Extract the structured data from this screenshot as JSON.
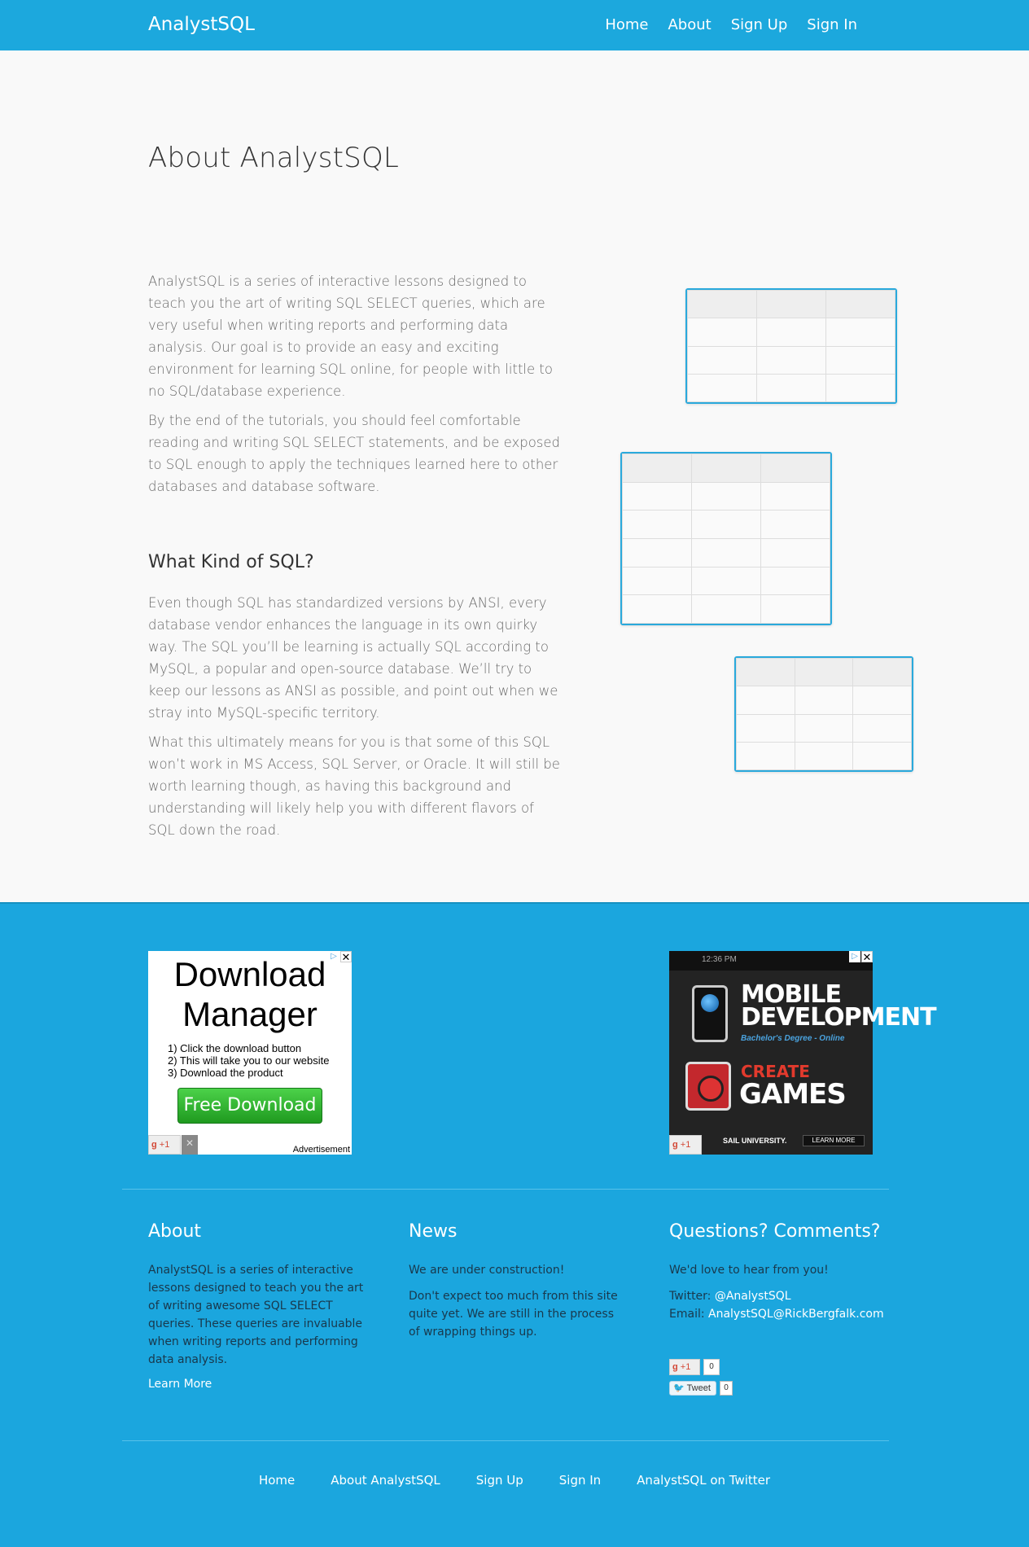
{
  "header": {
    "brand": "AnalystSQL",
    "nav": [
      "Home",
      "About",
      "Sign Up",
      "Sign In"
    ]
  },
  "main": {
    "title": "About AnalystSQL",
    "paragraphs_intro": [
      "AnalystSQL is a series of interactive lessons designed to teach you the art of writing SQL SELECT queries, which are very useful when writing reports and performing data analysis. Our goal is to provide an easy and exciting environment for learning SQL online, for people with little to no SQL/database experience.",
      "By the end of the tutorials, you should feel comfortable reading and writing SQL SELECT statements, and be exposed to SQL enough to apply the techniques learned here to other databases and database software."
    ],
    "subheading": "What Kind of SQL?",
    "paragraphs_sql": [
      "Even though SQL has standardized versions by ANSI, every database vendor enhances the language in its own quirky way. The SQL you’ll be learning is actually SQL according to MySQL, a popular and open-source database. We’ll try to keep our lessons as ANSI as possible, and point out when we stray into MySQL-specific territory.",
      "What this ultimately means for you is that some of this SQL won’t work in MS Access, SQL Server, or Oracle. It will still be worth learning though, as having this background and understanding will likely help you with different flavors of SQL down the road."
    ]
  },
  "ads": {
    "left": {
      "headline": "Download Manager",
      "steps": [
        "1) Click the download button",
        "2) This will take you to our website",
        "3) Download the product"
      ],
      "button": "Free Download",
      "footer": "Advertisement",
      "gplus": "+1",
      "close": "✕",
      "info": "▷"
    },
    "right": {
      "time": "12:36 PM",
      "line1": "MOBILE",
      "line2": "DEVELOPMENT",
      "sub": "Bachelor's Degree - Online",
      "create": "CREATE",
      "games": "GAMES",
      "sail": "SAIL UNIVERSITY.",
      "learn": "LEARN MORE",
      "gplus": "+1",
      "close": "✕",
      "info": "▷"
    }
  },
  "footer": {
    "about": {
      "title": "About",
      "text": "AnalystSQL is a series of interactive lessons designed to teach you the art of writing awesome SQL SELECT queries. These queries are invaluable when writing reports and performing data analysis.",
      "link": "Learn More"
    },
    "news": {
      "title": "News",
      "p1": "We are under construction!",
      "p2": "Don't expect too much from this site quite yet. We are still in the process of wrapping things up."
    },
    "questions": {
      "title": "Questions? Comments?",
      "intro": "We'd love to hear from you!",
      "twitter_label": "Twitter: ",
      "twitter": "@AnalystSQL",
      "email_label": "Email: ",
      "email": "AnalystSQL@RickBergfalk.com"
    },
    "social": {
      "gplus": "+1",
      "gplus_count": "0",
      "tweet": "Tweet",
      "tweet_count": "0"
    },
    "nav": [
      "Home",
      "About AnalystSQL",
      "Sign Up",
      "Sign In",
      "AnalystSQL on Twitter"
    ]
  }
}
